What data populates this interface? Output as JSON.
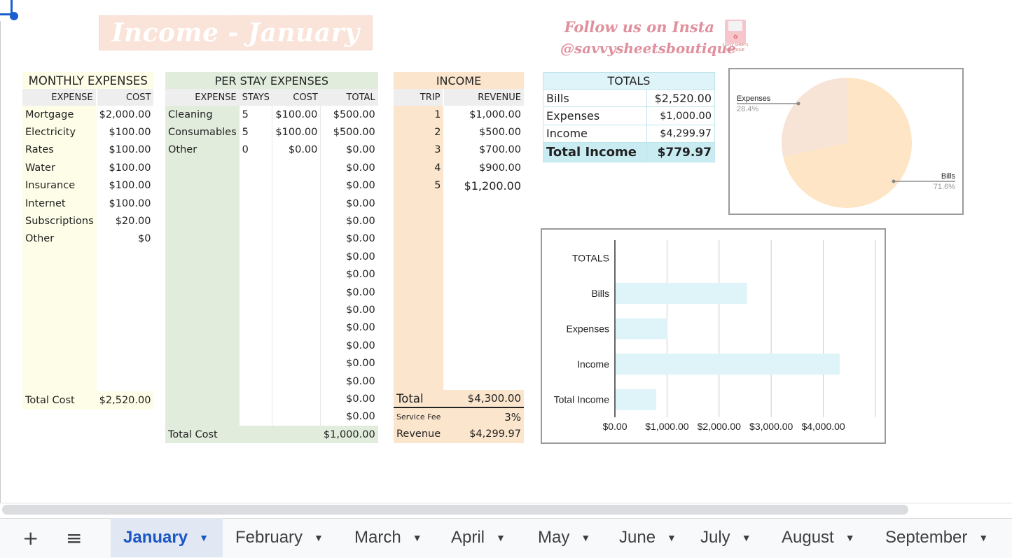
{
  "sheet_title": "Income - January",
  "promo": {
    "line1": "Follow us on Insta",
    "line2": "@savvysheetsboutique",
    "logo_text1": "SAVVY SHEETS",
    "logo_text2": "BOUTIQUE"
  },
  "monthly_expenses": {
    "title": "MONTHLY EXPENSES",
    "col_expense": "EXPENSE",
    "col_cost": "COST",
    "rows": [
      {
        "name": "Mortgage",
        "cost": "$2,000.00"
      },
      {
        "name": "Electricity",
        "cost": "$100.00"
      },
      {
        "name": "Rates",
        "cost": "$100.00"
      },
      {
        "name": "Water",
        "cost": "$100.00"
      },
      {
        "name": "Insurance",
        "cost": "$100.00"
      },
      {
        "name": "Internet",
        "cost": "$100.00"
      },
      {
        "name": "Subscriptions",
        "cost": "$20.00"
      },
      {
        "name": "Other",
        "cost": "$0"
      }
    ],
    "total_label": "Total Cost",
    "total_value": "$2,520.00"
  },
  "per_stay_expenses": {
    "title": "PER STAY EXPENSES",
    "col_expense": "EXPENSE",
    "col_stays": "STAYS",
    "col_cost": "COST",
    "col_total": "TOTAL",
    "rows": [
      {
        "name": "Cleaning",
        "stays": "5",
        "cost": "$100.00",
        "total": "$500.00"
      },
      {
        "name": "Consumables",
        "stays": "5",
        "cost": "$100.00",
        "total": "$500.00"
      },
      {
        "name": "Other",
        "stays": "0",
        "cost": "$0.00",
        "total": "$0.00"
      },
      {
        "name": "",
        "stays": "",
        "cost": "",
        "total": "$0.00"
      },
      {
        "name": "",
        "stays": "",
        "cost": "",
        "total": "$0.00"
      },
      {
        "name": "",
        "stays": "",
        "cost": "",
        "total": "$0.00"
      },
      {
        "name": "",
        "stays": "",
        "cost": "",
        "total": "$0.00"
      },
      {
        "name": "",
        "stays": "",
        "cost": "",
        "total": "$0.00"
      },
      {
        "name": "",
        "stays": "",
        "cost": "",
        "total": "$0.00"
      },
      {
        "name": "",
        "stays": "",
        "cost": "",
        "total": "$0.00"
      },
      {
        "name": "",
        "stays": "",
        "cost": "",
        "total": "$0.00"
      },
      {
        "name": "",
        "stays": "",
        "cost": "",
        "total": "$0.00"
      },
      {
        "name": "",
        "stays": "",
        "cost": "",
        "total": "$0.00"
      },
      {
        "name": "",
        "stays": "",
        "cost": "",
        "total": "$0.00"
      },
      {
        "name": "",
        "stays": "",
        "cost": "",
        "total": "$0.00"
      },
      {
        "name": "",
        "stays": "",
        "cost": "",
        "total": "$0.00"
      },
      {
        "name": "",
        "stays": "",
        "cost": "",
        "total": "$0.00"
      },
      {
        "name": "",
        "stays": "",
        "cost": "",
        "total": "$0.00"
      }
    ],
    "total_label": "Total Cost",
    "total_value": "$1,000.00"
  },
  "income": {
    "title": "INCOME",
    "col_trip": "TRIP",
    "col_revenue": "REVENUE",
    "rows": [
      {
        "trip": "1",
        "revenue": "$1,000.00"
      },
      {
        "trip": "2",
        "revenue": "$500.00"
      },
      {
        "trip": "3",
        "revenue": "$700.00"
      },
      {
        "trip": "4",
        "revenue": "$900.00"
      },
      {
        "trip": "5",
        "revenue": "$1,200.00"
      }
    ],
    "total_label": "Total",
    "total_value": "$4,300.00",
    "fee_label": "Service Fee",
    "fee_value": "3%",
    "revenue_label": "Revenue",
    "revenue_value": "$4,299.97"
  },
  "totals": {
    "title": "TOTALS",
    "rows": [
      {
        "label": "Bills",
        "value": "$2,520.00"
      },
      {
        "label": "Expenses",
        "value": "$1,000.00"
      },
      {
        "label": "Income",
        "value": "$4,299.97"
      }
    ],
    "total_label": "Total Income",
    "total_value": "$779.97"
  },
  "chart_data": [
    {
      "type": "pie",
      "title": "",
      "labels": [
        "Bills",
        "Expenses"
      ],
      "values": [
        2520,
        1000
      ],
      "percent_labels": [
        "71.6%",
        "28.4%"
      ],
      "colors": [
        "#fde5c6",
        "#f8e3d7"
      ],
      "legend": "labels on slices"
    },
    {
      "type": "bar",
      "orientation": "horizontal",
      "title": "",
      "categories": [
        "TOTALS",
        "Bills",
        "Expenses",
        "Income",
        "Total Income"
      ],
      "values": [
        null,
        2520,
        1000,
        4299.97,
        779.97
      ],
      "xlim": [
        0,
        5000
      ],
      "xticks": [
        "$0.00",
        "$1,000.00",
        "$2,000.00",
        "$3,000.00",
        "$4,000.00"
      ],
      "xtick_values": [
        0,
        1000,
        2000,
        3000,
        4000
      ],
      "bar_color": "#dff4f9",
      "grid": true
    }
  ],
  "sheet_tabs": {
    "add_label": "+",
    "menu_label": "≡",
    "active": "January",
    "tabs": [
      "January",
      "February",
      "March",
      "April",
      "May",
      "June",
      "July",
      "August",
      "September"
    ]
  }
}
